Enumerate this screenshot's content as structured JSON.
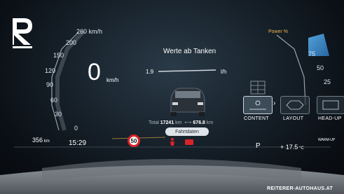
{
  "brand": {
    "logo_letter": "R",
    "watermark": "REITERER-AUTOHAUS.AT"
  },
  "speedometer": {
    "speed": "0",
    "unit": "km/h",
    "scale_top": "260 km/h",
    "scale": [
      "200",
      "150",
      "120",
      "90",
      "60",
      "30",
      "0"
    ]
  },
  "center": {
    "title": "Werte ab Tanken",
    "consumption_value": "1.9",
    "consumption_unit": "l/h",
    "total_label": "Total",
    "total_value": "17241",
    "total_unit": "km",
    "trip_value": "676.8",
    "trip_unit": "km",
    "tab_label": "Fahrtdaten"
  },
  "status": {
    "range_value": "356",
    "range_unit": "km",
    "clock": "15:29",
    "speed_limit": "50",
    "gear": "P",
    "temperature": "+ 17.5",
    "temperature_unit": "°C",
    "warmup_label": "WARM-UP"
  },
  "power_gauge": {
    "label": "Power %",
    "ticks": [
      "100",
      "75",
      "50",
      "25"
    ]
  },
  "menu": {
    "items": [
      {
        "label": "CONTENT",
        "active": true
      },
      {
        "label": "LAYOUT",
        "active": false
      },
      {
        "label": "HEAD-UP",
        "active": false
      }
    ]
  },
  "colors": {
    "accent": "#f0b44a",
    "limit_ring": "#d8232a",
    "power_blue": "#4aa3e8"
  }
}
